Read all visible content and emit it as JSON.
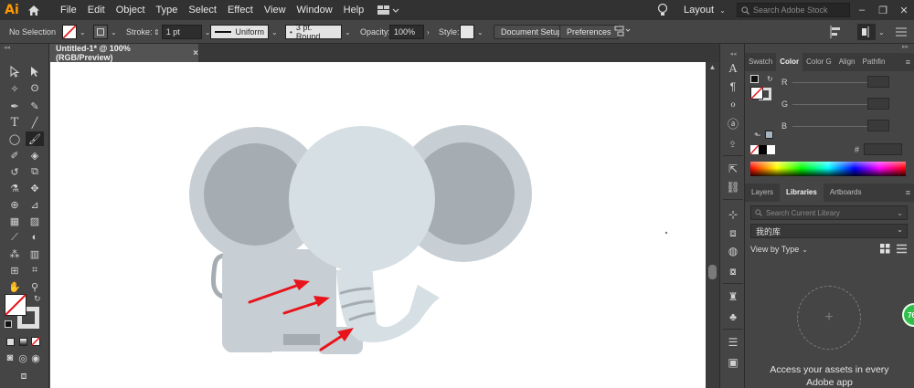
{
  "app": {
    "logo_text": "Ai",
    "menus": [
      "File",
      "Edit",
      "Object",
      "Type",
      "Select",
      "Effect",
      "View",
      "Window",
      "Help"
    ],
    "workspace_label": "Layout",
    "search_placeholder": "Search Adobe Stock",
    "window_controls": [
      "–",
      "❐",
      "✕"
    ]
  },
  "control_bar": {
    "selection_label": "No Selection",
    "stroke_label": "Stroke:",
    "stroke_weight": "1 pt",
    "profile_label": "Uniform",
    "brush_label": "3 pt. Round",
    "opacity_label": "Opacity:",
    "opacity_value": "100%",
    "style_label": "Style:",
    "document_setup_label": "Document Setup",
    "preferences_label": "Preferences"
  },
  "document": {
    "tab_title": "Untitled-1* @ 100% (RGB/Preview)",
    "tab_close": "×"
  },
  "tools": [
    "selection-tool",
    "direct-selection-tool",
    "magic-wand-tool",
    "lasso-tool",
    "pen-tool",
    "curvature-tool",
    "type-tool",
    "line-tool",
    "ellipse-tool",
    "paintbrush-tool",
    "shaper-tool",
    "eraser-tool",
    "rotate-tool",
    "scale-tool",
    "width-tool",
    "free-transform-tool",
    "shape-builder-tool",
    "perspective-grid-tool",
    "mesh-tool",
    "gradient-tool",
    "eyedropper-tool",
    "blend-tool",
    "symbol-sprayer-tool",
    "column-graph-tool",
    "artboard-tool",
    "slice-tool",
    "hand-tool",
    "zoom-tool"
  ],
  "color_panel": {
    "tabs": [
      "Swatch",
      "Color",
      "Color G",
      "Align",
      "Pathfin"
    ],
    "active_tab": "Color",
    "channels": [
      "R",
      "G",
      "B"
    ],
    "hex_symbol": "#"
  },
  "libraries_panel": {
    "tabs": [
      "Layers",
      "Libraries",
      "Artboards"
    ],
    "active_tab": "Libraries",
    "search_placeholder": "Search Current Library",
    "library_name": "我的库",
    "view_by_label": "View by Type",
    "add_symbol": "+",
    "empty_message": "Access your assets in every Adobe app"
  },
  "badge_text": "76",
  "colors": {
    "menubar": "#323232",
    "panel": "#454545",
    "canvas": "#535353",
    "artboard": "#ffffff",
    "elephant_body": "#c8cfd4",
    "elephant_ear_inner": "#a6adb2",
    "elephant_head": "#d6dfe3",
    "arrow_red": "#e8141b",
    "logo_orange": "#ff9a00"
  }
}
